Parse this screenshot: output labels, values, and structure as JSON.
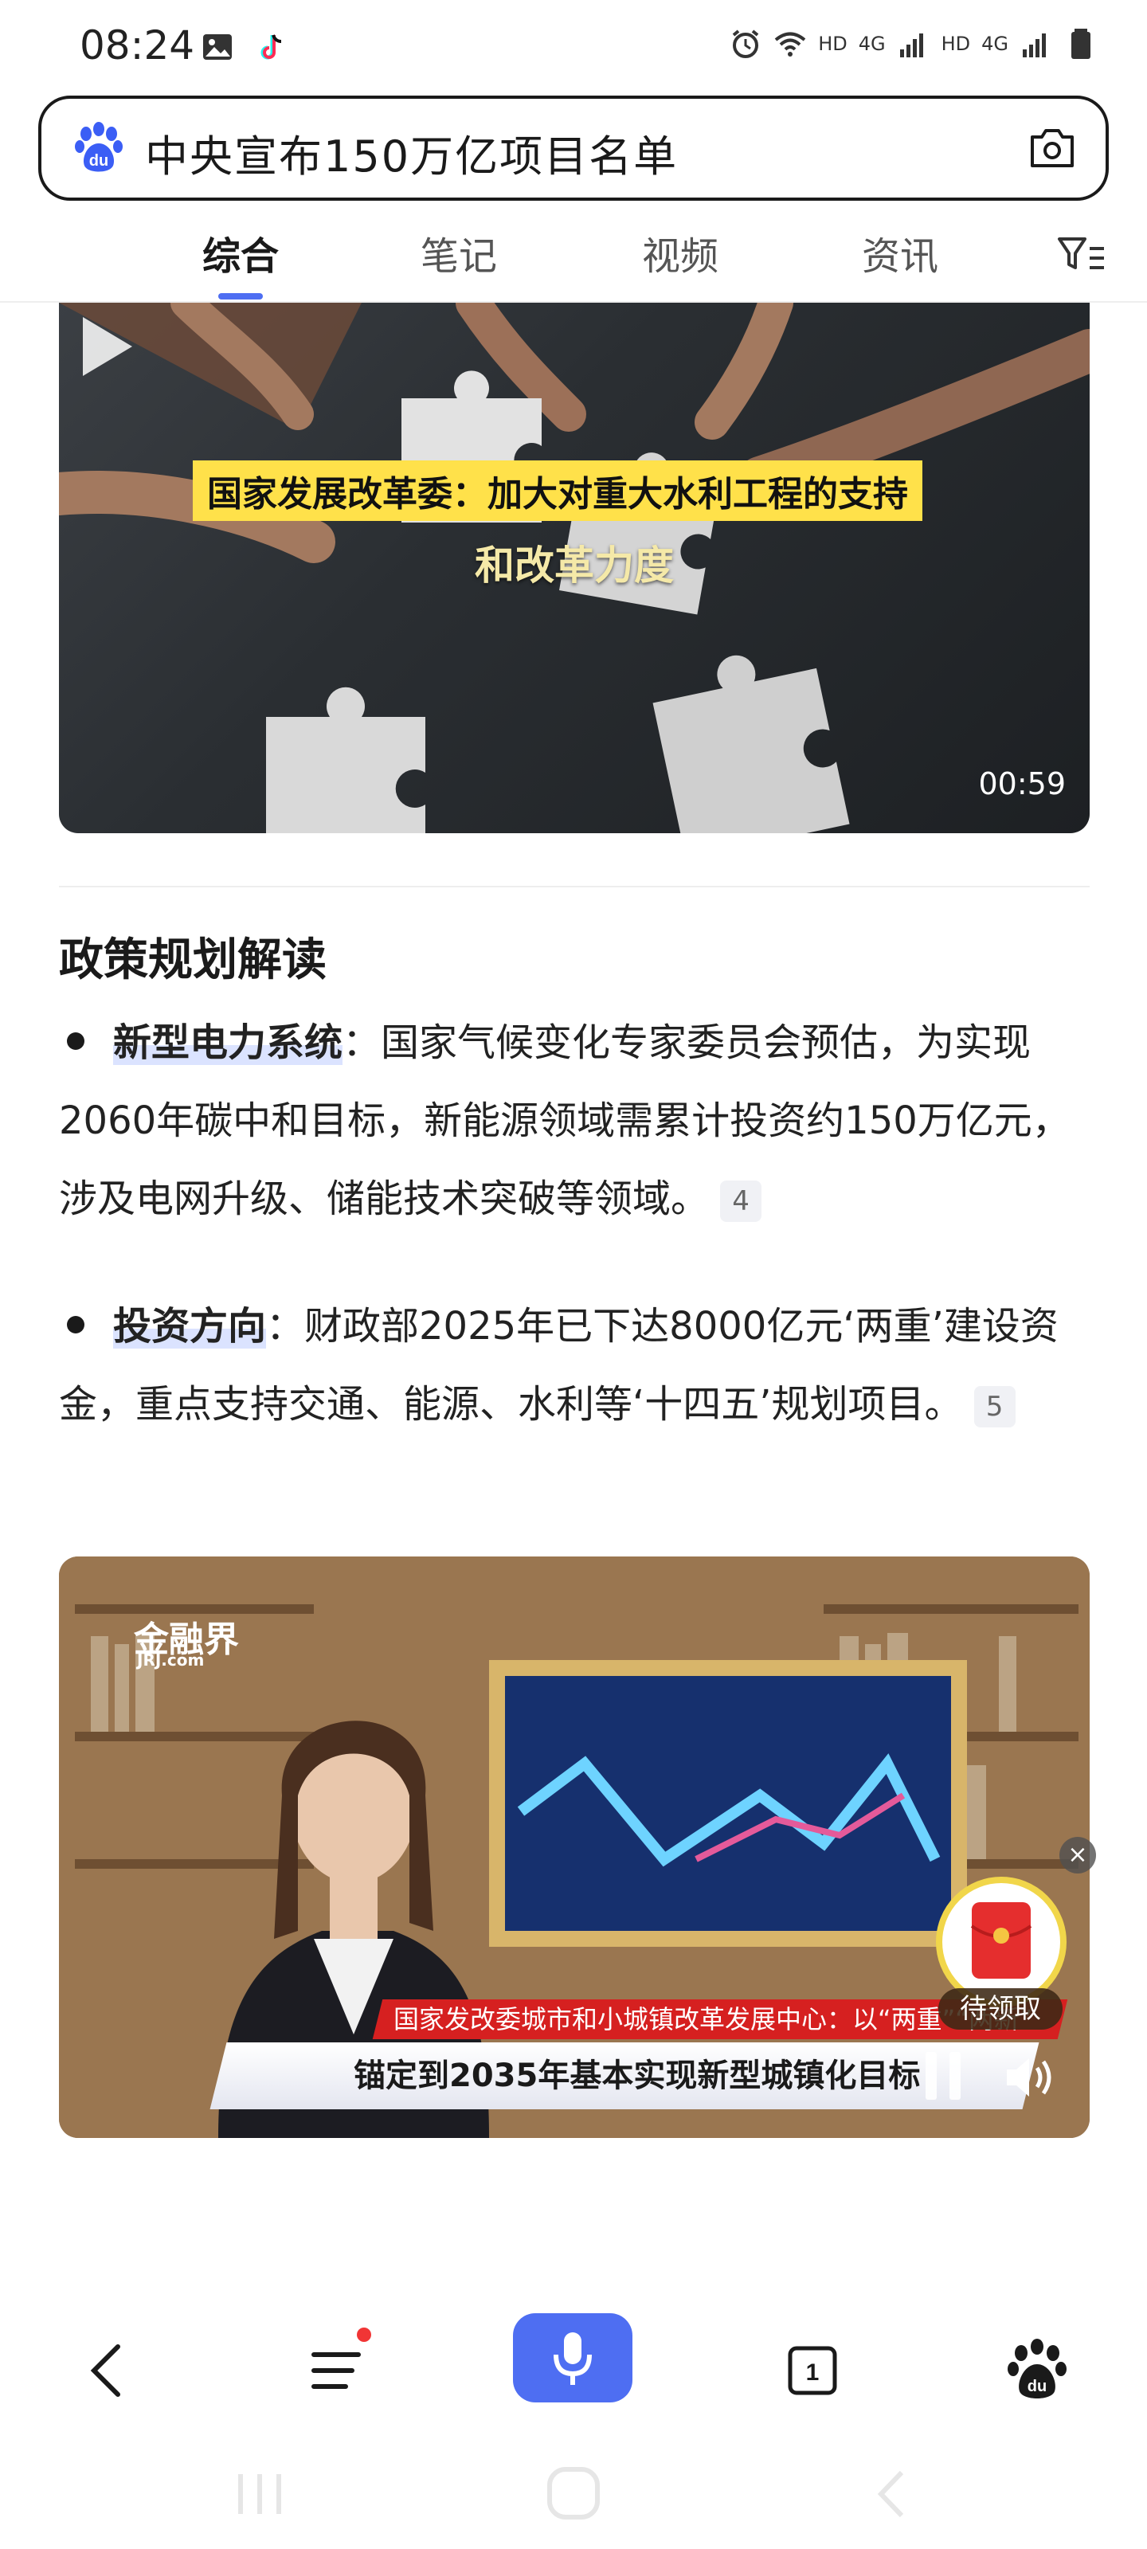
{
  "status_bar": {
    "time": "08:24",
    "network_labels": [
      "HD",
      "4G",
      "HD",
      "4G"
    ]
  },
  "search": {
    "query": "中央宣布150万亿项目名单",
    "logo_text": "du"
  },
  "tabs": [
    {
      "label": "综合",
      "active": true
    },
    {
      "label": "笔记",
      "active": false
    },
    {
      "label": "视频",
      "active": false
    },
    {
      "label": "资讯",
      "active": false
    }
  ],
  "video1": {
    "caption_line1": "国家发展改革委：加大对重大水利工程的支持",
    "caption_line2": "和改革力度",
    "duration": "00:59"
  },
  "section": {
    "title": "政策规划解读",
    "bullets": [
      {
        "keyword": "新型电力系统",
        "text": "：国家气候变化专家委员会预估，为实现2060年碳中和目标，新能源领域需累计投资约150万亿元，涉及电网升级、储能技术突破等领域。",
        "ref": "4"
      },
      {
        "keyword": "投资方向",
        "text": "：财政部2025年已下达8000亿元‘两重’建设资金，重点支持交通、能源、水利等‘十四五’规划项目。",
        "ref": "5"
      }
    ]
  },
  "video2": {
    "logo": "金融界",
    "logo_sub": "JRJ.com",
    "ticker_top": "国家发改委城市和小城镇改革发展中心：以“两重”“两新”",
    "ticker_main": "锚定到2035年基本实现新型城镇化目标"
  },
  "floating": {
    "redpacket_label": "待领取",
    "close": "×"
  },
  "bottom_nav": {
    "tab_count": "1",
    "baidu_logo_text": "du"
  },
  "colors": {
    "accent": "#4e6ef2",
    "ticker_red": "#d62020",
    "caption_yellow": "#ffe14a"
  }
}
